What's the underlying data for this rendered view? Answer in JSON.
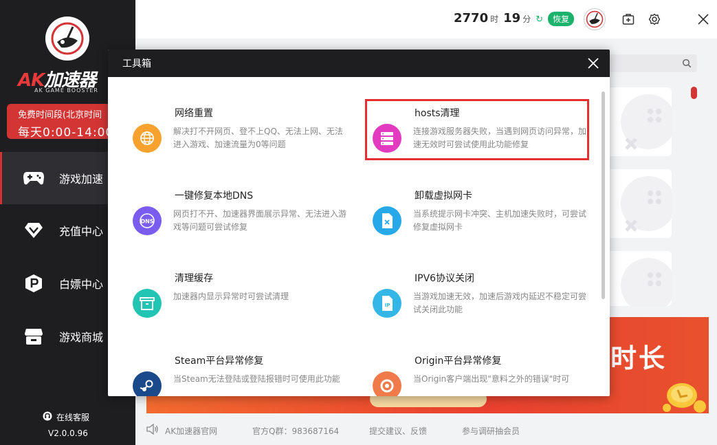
{
  "app": {
    "brand": "AK加速器",
    "brand_sub": "AK GAME BOOSTER",
    "version": "V2.0.0.96"
  },
  "sidebar": {
    "free_banner": {
      "line1": "免费时间段(北京时间",
      "line2": "每天0:00-14:00"
    },
    "items": [
      {
        "label": "游戏加速",
        "icon": "gamepad-icon",
        "active": true
      },
      {
        "label": "充值中心",
        "icon": "diamond-icon"
      },
      {
        "label": "白嫖中心",
        "icon": "p-badge-icon"
      },
      {
        "label": "游戏商城",
        "icon": "shop-icon"
      }
    ],
    "support": "在线客服"
  },
  "topbar": {
    "hours": "2770",
    "hours_unit": "时",
    "minutes": "19",
    "minutes_unit": "分",
    "restore_label": "恢复"
  },
  "background": {
    "banner_text": "时长"
  },
  "footer": {
    "official_site": "AK加速器官网",
    "qq_group": "官方Q群：983687164",
    "feedback": "提交建议、反馈",
    "survey": "参与调研抽会员"
  },
  "modal": {
    "title": "工具箱",
    "tools": [
      {
        "title": "网络重置",
        "desc": "解决打不开网页、登不上QQ、无法上网、无法进入游戏、加速流量为0等问题",
        "icon": "globe-icon",
        "color": "#f7a22e"
      },
      {
        "title": "hosts清理",
        "desc": "连接游戏服务器失败，当遇到网页访问异常，加速无效时可尝试使用此功能修复",
        "icon": "server-icon",
        "color": "#e33bc0",
        "highlighted": true
      },
      {
        "title": "一键修复本地DNS",
        "desc": "网页打不开、加速器界面展示异常、无法进入游戏等问题可尝试修复",
        "icon": "dns-icon",
        "color": "#7b5cf0"
      },
      {
        "title": "卸载虚拟网卡",
        "desc": "当系统提示网卡冲突、主机加速失败时，可尝试修复虚拟网卡",
        "icon": "sim-card-icon",
        "color": "#27a8e8"
      },
      {
        "title": "清理缓存",
        "desc": "加速器内显示异常时可尝试清理",
        "icon": "box-icon",
        "color": "#22c4b4"
      },
      {
        "title": "IPV6协议关闭",
        "desc": "当游戏加速无效，加速后游戏内延迟不稳定可尝试关闭此功能",
        "icon": "ip-file-icon",
        "color": "#34b7e6"
      },
      {
        "title": "Steam平台异常修复",
        "desc": "当Steam无法登陆或登陆报错时可使用此功能",
        "icon": "steam-icon",
        "color": "#1b4a8a"
      },
      {
        "title": "Origin平台异常修复",
        "desc": "当Origin客户端出现\"意料之外的错误\"时可",
        "icon": "origin-icon",
        "color": "#f07a4a"
      }
    ]
  }
}
